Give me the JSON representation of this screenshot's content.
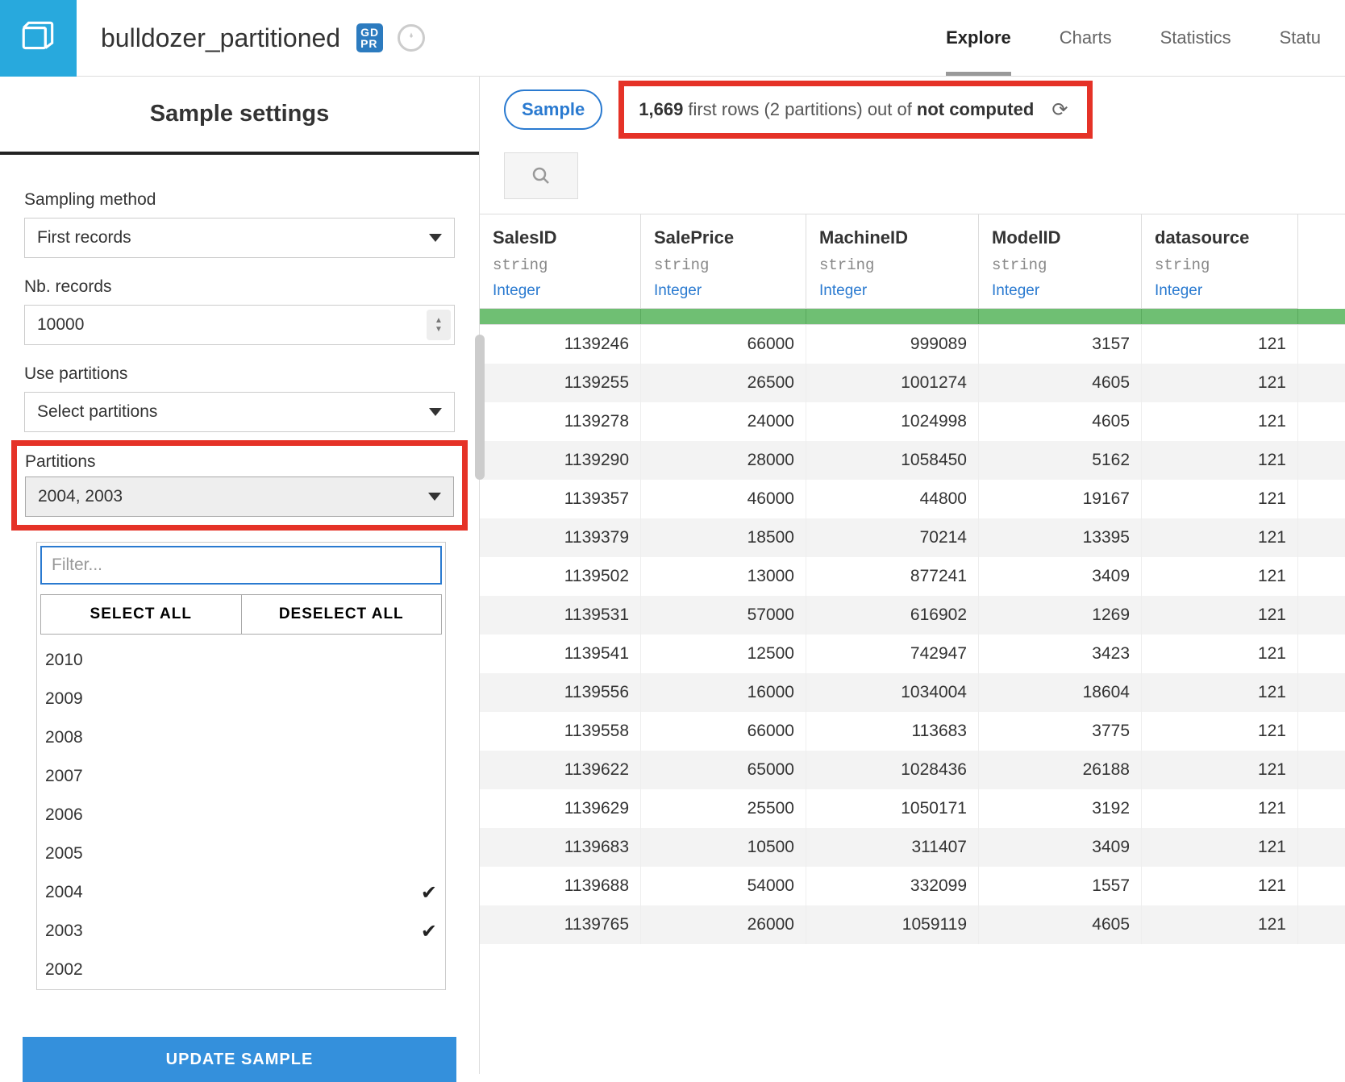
{
  "header": {
    "title": "bulldozer_partitioned",
    "badge": "GD\nPR",
    "tabs": [
      "Explore",
      "Charts",
      "Statistics",
      "Statu"
    ],
    "active_tab": 0
  },
  "sidebar": {
    "title": "Sample settings",
    "sampling_method_label": "Sampling method",
    "sampling_method_value": "First records",
    "nb_records_label": "Nb. records",
    "nb_records_value": "10000",
    "use_partitions_label": "Use partitions",
    "use_partitions_value": "Select partitions",
    "partitions_label": "Partitions",
    "partitions_value": "2004, 2003",
    "filter_placeholder": "Filter...",
    "select_all": "SELECT ALL",
    "deselect_all": "DESELECT ALL",
    "options": [
      {
        "label": "2010",
        "checked": false
      },
      {
        "label": "2009",
        "checked": false
      },
      {
        "label": "2008",
        "checked": false
      },
      {
        "label": "2007",
        "checked": false
      },
      {
        "label": "2006",
        "checked": false
      },
      {
        "label": "2005",
        "checked": false
      },
      {
        "label": "2004",
        "checked": true
      },
      {
        "label": "2003",
        "checked": true
      },
      {
        "label": "2002",
        "checked": false
      }
    ],
    "update_btn": "UPDATE SAMPLE"
  },
  "main": {
    "sample_btn": "Sample",
    "info_count": "1,669",
    "info_mid": " first rows (2 partitions) out of ",
    "info_tail": "not computed",
    "columns": [
      {
        "name": "SalesID",
        "type": "string",
        "meaning": "Integer"
      },
      {
        "name": "SalePrice",
        "type": "string",
        "meaning": "Integer"
      },
      {
        "name": "MachineID",
        "type": "string",
        "meaning": "Integer"
      },
      {
        "name": "ModelID",
        "type": "string",
        "meaning": "Integer"
      },
      {
        "name": "datasource",
        "type": "string",
        "meaning": "Integer"
      }
    ],
    "rows": [
      [
        "1139246",
        "66000",
        "999089",
        "3157",
        "121"
      ],
      [
        "1139255",
        "26500",
        "1001274",
        "4605",
        "121"
      ],
      [
        "1139278",
        "24000",
        "1024998",
        "4605",
        "121"
      ],
      [
        "1139290",
        "28000",
        "1058450",
        "5162",
        "121"
      ],
      [
        "1139357",
        "46000",
        "44800",
        "19167",
        "121"
      ],
      [
        "1139379",
        "18500",
        "70214",
        "13395",
        "121"
      ],
      [
        "1139502",
        "13000",
        "877241",
        "3409",
        "121"
      ],
      [
        "1139531",
        "57000",
        "616902",
        "1269",
        "121"
      ],
      [
        "1139541",
        "12500",
        "742947",
        "3423",
        "121"
      ],
      [
        "1139556",
        "16000",
        "1034004",
        "18604",
        "121"
      ],
      [
        "1139558",
        "66000",
        "113683",
        "3775",
        "121"
      ],
      [
        "1139622",
        "65000",
        "1028436",
        "26188",
        "121"
      ],
      [
        "1139629",
        "25500",
        "1050171",
        "3192",
        "121"
      ],
      [
        "1139683",
        "10500",
        "311407",
        "3409",
        "121"
      ],
      [
        "1139688",
        "54000",
        "332099",
        "1557",
        "121"
      ],
      [
        "1139765",
        "26000",
        "1059119",
        "4605",
        "121"
      ]
    ]
  }
}
